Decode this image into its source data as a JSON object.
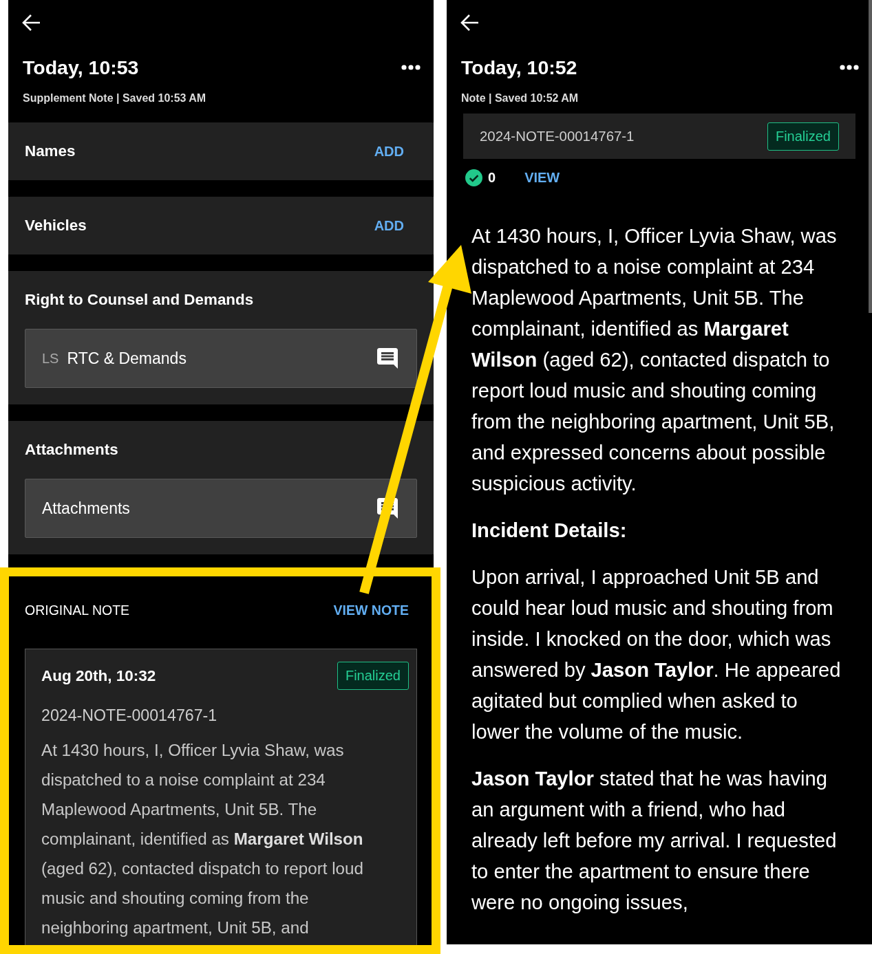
{
  "left_screen": {
    "title": "Today, 10:53",
    "subtitle": "Supplement Note | Saved 10:53 AM",
    "sections": [
      {
        "kind": "add",
        "heading": "Names",
        "action": "ADD"
      },
      {
        "kind": "add",
        "heading": "Vehicles",
        "action": "ADD"
      },
      {
        "kind": "field",
        "heading": "Right to Counsel and Demands",
        "field": {
          "prefix": "LS",
          "value": "RTC & Demands"
        }
      },
      {
        "kind": "field",
        "heading": "Attachments",
        "field": {
          "value": "Attachments"
        }
      }
    ],
    "original_note": {
      "label": "ORIGINAL NOTE",
      "action": "VIEW NOTE",
      "card": {
        "date": "Aug 20th, 10:32",
        "status": "Finalized",
        "number": "2024-NOTE-00014767-1",
        "text": "At 1430 hours, I, Officer Lyvia Shaw, was dispatched to a noise complaint at 234 Maplewood Apartments, Unit 5B. The complainant, identified as **Margaret Wilson** (aged 62), contacted dispatch to report loud music and shouting coming from the neighboring apartment, Unit 5B, and"
      }
    }
  },
  "right_screen": {
    "title": "Today, 10:52",
    "subtitle": "Note | Saved 10:52 AM",
    "note_bar": {
      "number": "2024-NOTE-00014767-1",
      "status": "Finalized"
    },
    "approvals": {
      "count": "0",
      "action": "VIEW"
    },
    "body": [
      {
        "kind": "paragraph",
        "text": "At 1430 hours, I, Officer Lyvia Shaw, was dispatched to a noise complaint at 234 Maplewood Apartments, Unit 5B. The complainant, identified as **Margaret Wilson** (aged 62), contacted dispatch to report loud music and shouting coming from the neighboring apartment, Unit 5B, and expressed concerns about possible suspicious activity."
      },
      {
        "kind": "heading",
        "text": "Incident Details:"
      },
      {
        "kind": "paragraph",
        "text": "Upon arrival, I approached Unit 5B and could hear loud music and shouting from inside. I knocked on the door, which was answered by **Jason Taylor**. He appeared agitated but complied when asked to lower the volume of the music."
      },
      {
        "kind": "paragraph",
        "text": "**Jason Taylor** stated that he was having an argument with a friend, who had already left before my arrival. I requested to enter the apartment to ensure there were no ongoing issues,"
      }
    ]
  }
}
